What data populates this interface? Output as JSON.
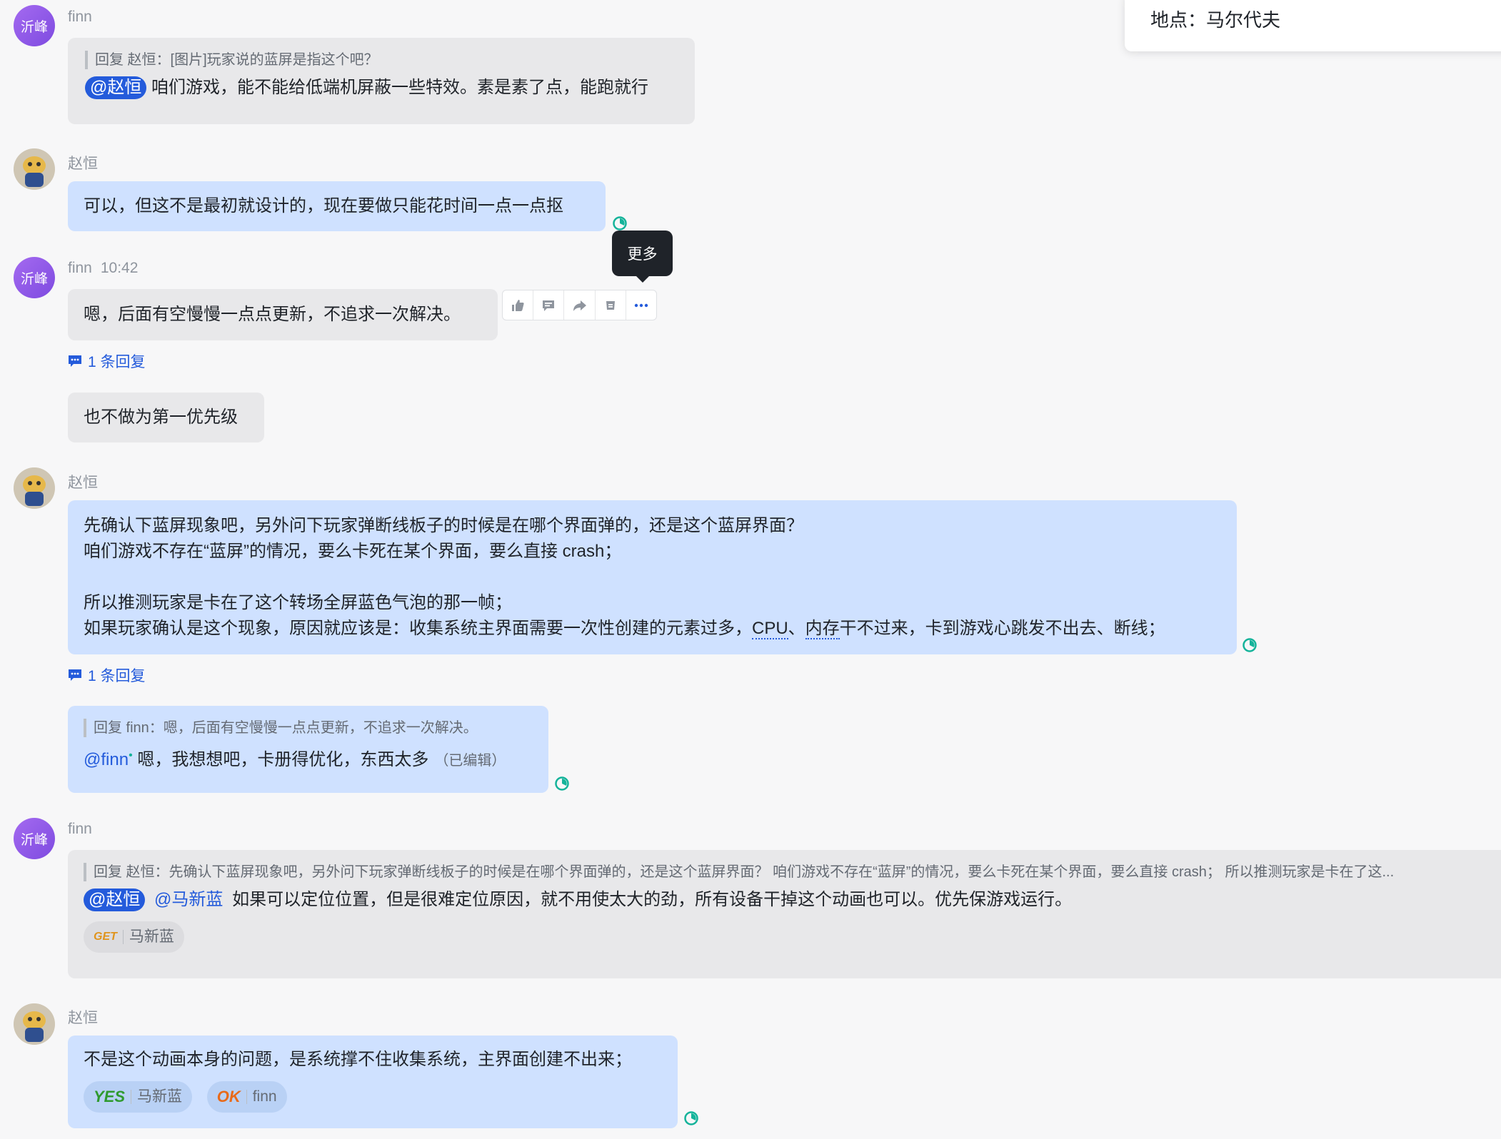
{
  "location_panel": {
    "text": "地点：马尔代夫"
  },
  "tooltip": {
    "label": "更多"
  },
  "colors": {
    "accent": "#245bdb",
    "bubble_blue": "#cfe1ff",
    "bubble_gray": "#e8e8ea",
    "read_receipt": "#14b39a"
  },
  "icons": [
    "thumbs-up-icon",
    "comment-icon",
    "forward-icon",
    "pin-icon",
    "more-icon",
    "reply-thread-icon",
    "read-receipt-icon"
  ],
  "messages": [
    {
      "avatar": "沂峰",
      "sender": "finn",
      "quote": "回复 赵恒：[图片]玩家说的蓝屏是指这个吧？",
      "mention": "@赵恒",
      "text": "咱们游戏，能不能给低端机屏蔽一些特效。素是素了点，能跑就行"
    },
    {
      "sender": "赵恒",
      "text": "可以，但这不是最初就设计的，现在要做只能花时间一点一点抠"
    },
    {
      "avatar": "沂峰",
      "sender": "finn",
      "time": "10:42",
      "text": "嗯，后面有空慢慢一点点更新，不追求一次解决。",
      "reply_count": "1 条回复"
    },
    {
      "text": "也不做为第一优先级"
    },
    {
      "sender": "赵恒",
      "lines": [
        "先确认下蓝屏现象吧，另外问下玩家弹断线板子的时候是在哪个界面弹的，还是这个蓝屏界面？",
        "咱们游戏不存在“蓝屏”的情况，要么卡死在某个界面，要么直接 crash；",
        "",
        "所以推测玩家是卡在了这个转场全屏蓝色气泡的那一帧；"
      ],
      "last_line_a": "如果玩家确认是这个现象，原因就应该是：收集系统主界面需要一次性创建的元素过多，",
      "last_line_cpu": "CPU",
      "last_line_sep": "、",
      "last_line_mem": "内存",
      "last_line_b": "干不过来，卡到游戏心跳发不出去、断线；",
      "reply_count": "1 条回复"
    },
    {
      "quote": "回复 finn：嗯，后面有空慢慢一点点更新，不追求一次解决。",
      "mention": "@finn",
      "text": "嗯，我想想吧，卡册得优化，东西太多",
      "edited": "（已编辑）"
    },
    {
      "avatar": "沂峰",
      "sender": "finn",
      "quote": "回复 赵恒：先确认下蓝屏现象吧，另外问下玩家弹断线板子的时候是在哪个界面弹的，还是这个蓝屏界面？ 咱们游戏不存在“蓝屏”的情况，要么卡死在某个界面，要么直接 crash； 所以推测玩家是卡在了这...",
      "mention": "@赵恒",
      "mention2": "@马新蓝",
      "text": "如果可以定位位置，但是很难定位原因，就不用使太大的劲，所有设备干掉这个动画也可以。优先保游戏运行。",
      "reaction": {
        "emoji": "GET",
        "user": "马新蓝"
      }
    },
    {
      "sender": "赵恒",
      "text": "不是这个动画本身的问题，是系统撑不住收集系统，主界面创建不出来；",
      "reactions": [
        {
          "emoji": "YES",
          "user": "马新蓝"
        },
        {
          "emoji": "OK",
          "user": "finn"
        }
      ]
    }
  ]
}
